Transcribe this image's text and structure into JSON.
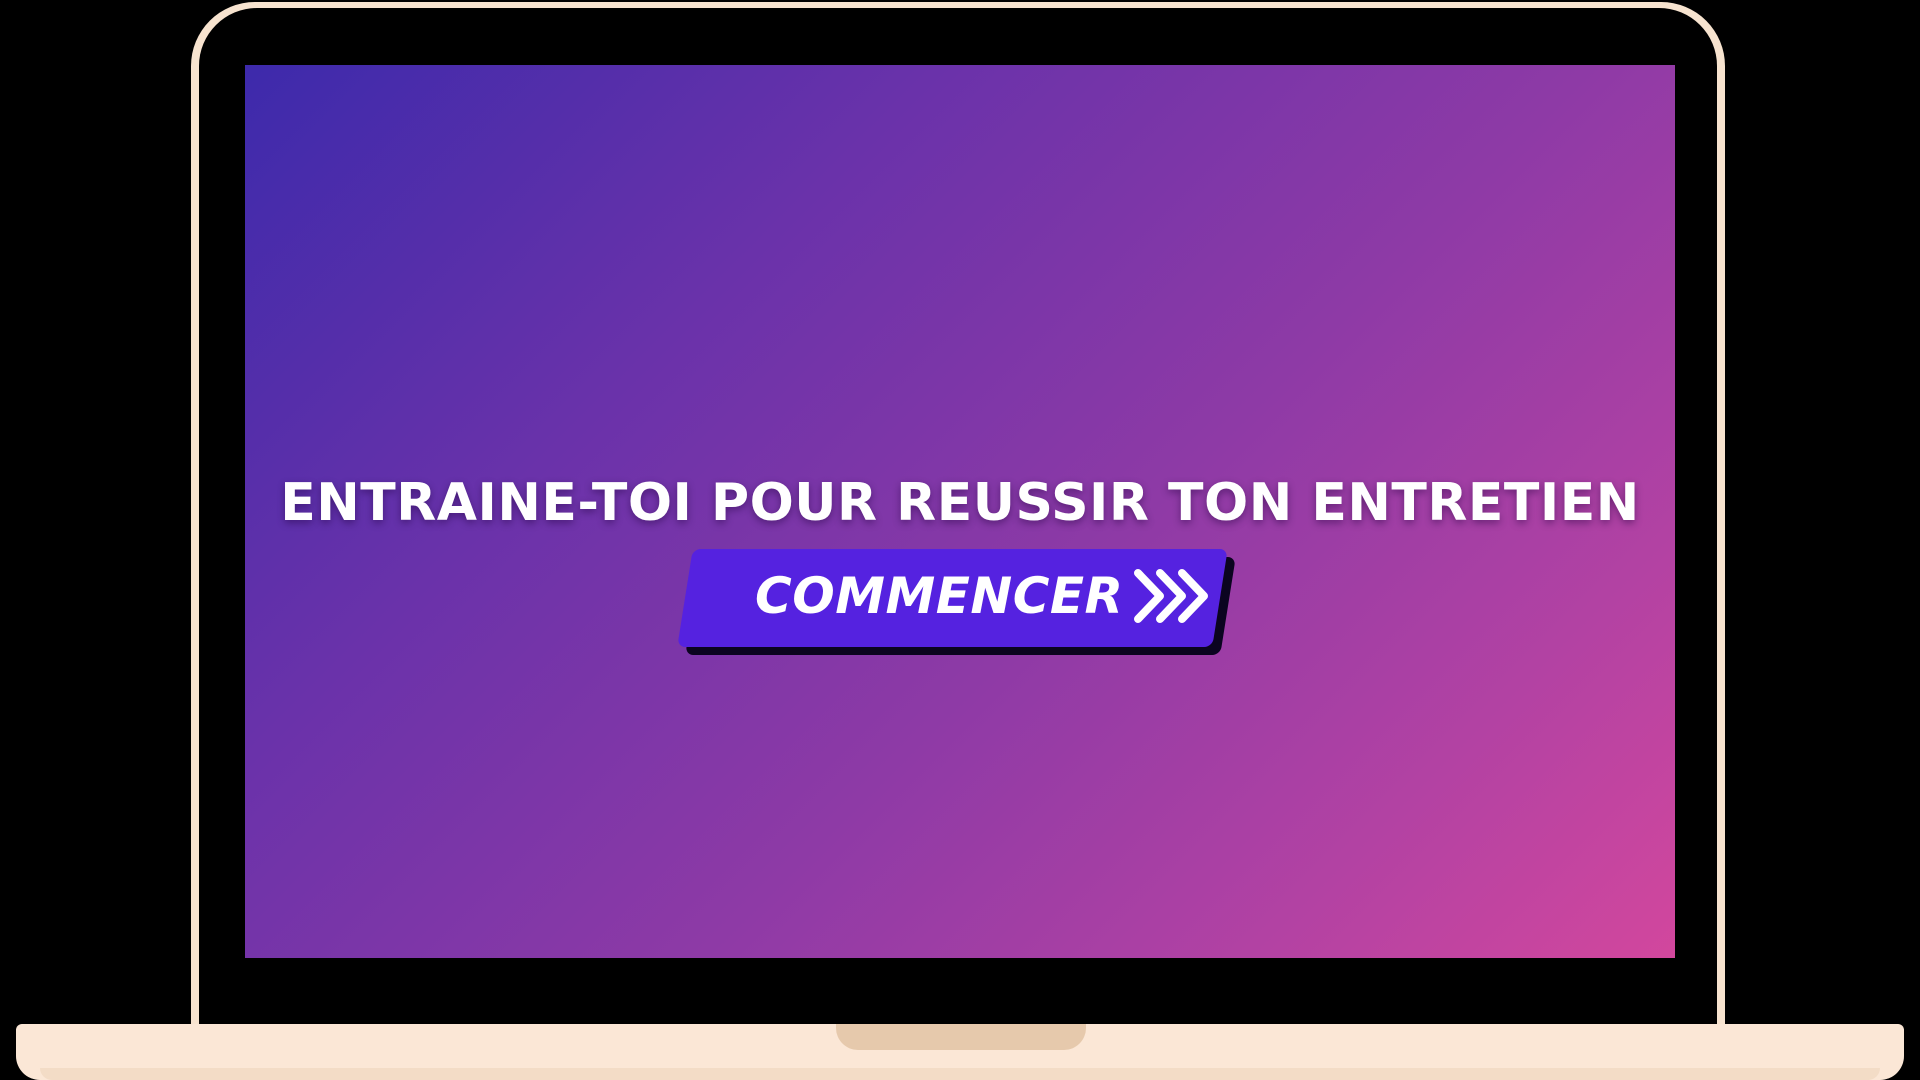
{
  "screen": {
    "headline": "ENTRAINE-TOI POUR REUSSIR TON ENTRETIEN",
    "cta_label": "COMMENCER",
    "cta_icon": "triple-chevron-right-icon"
  },
  "colors": {
    "gradient_start": "#3d2aab",
    "gradient_end": "#d2479d",
    "button": "#5522e0",
    "laptop_frame": "#f7e3cf"
  }
}
